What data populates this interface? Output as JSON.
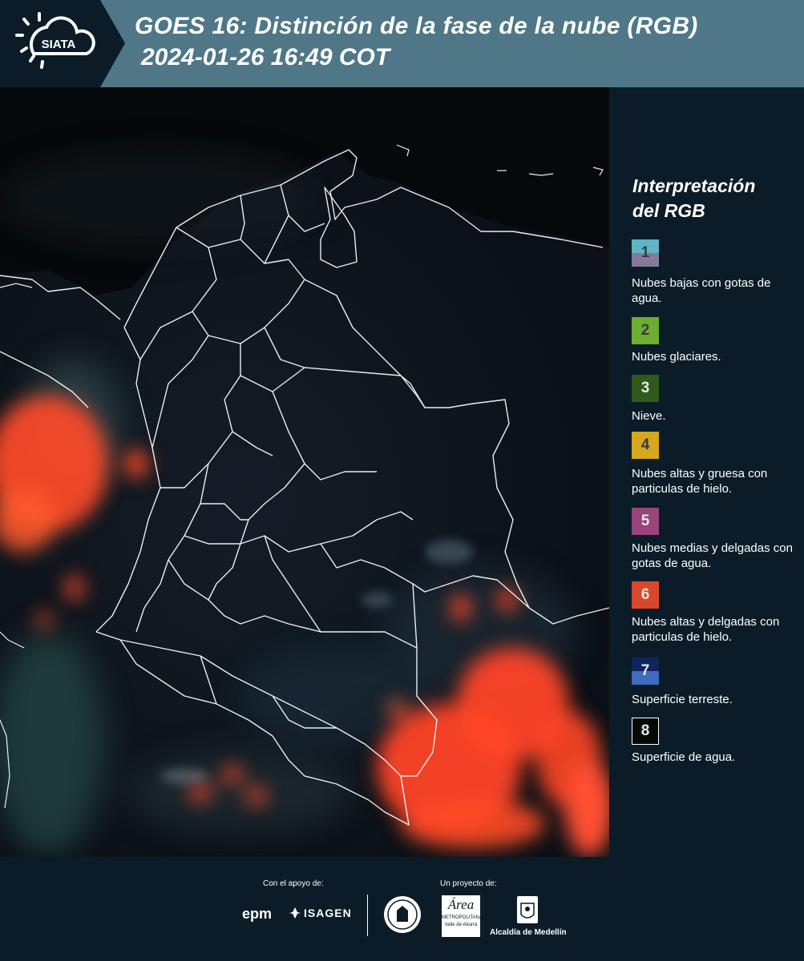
{
  "header": {
    "logo_text": "SIATA",
    "title_line1": "GOES 16: Distinción de la fase de la nube (RGB)",
    "title_line2": "2024-01-26 16:49 COT"
  },
  "legend": {
    "title_line1": "Interpretación",
    "title_line2": "del RGB",
    "items": [
      {
        "number": "1",
        "label": "Nubes bajas con gotas de agua.",
        "color_top": "#5fb5c6",
        "color_bottom": "#857a99"
      },
      {
        "number": "2",
        "label": "Nubes glaciares.",
        "color_top": "#6cae2f",
        "color_bottom": "#6cae2f"
      },
      {
        "number": "3",
        "label": "Nieve.",
        "color_top": "#2f5a1b",
        "color_bottom": "#2f5a1b"
      },
      {
        "number": "4",
        "label": "Nubes altas y gruesa con particulas de hielo.",
        "color_top": "#d7a71d",
        "color_bottom": "#d7a71d"
      },
      {
        "number": "5",
        "label": "Nubes medias y delgadas con gotas de agua.",
        "color_top": "#99447a",
        "color_bottom": "#99447a"
      },
      {
        "number": "6",
        "label": "Nubes altas y delgadas con particulas de hielo.",
        "color_top": "#d9482a",
        "color_bottom": "#d9482a"
      },
      {
        "number": "7",
        "label": "Superficie terreste.",
        "color_top": "#0e2560",
        "color_bottom": "#3f6cc0"
      },
      {
        "number": "8",
        "label": "Superficie de agua.",
        "color_top": "#050a06",
        "color_bottom": "#050a06"
      }
    ]
  },
  "footer": {
    "support_label": "Con el apoyo de:",
    "project_label": "Un proyecto de:",
    "sponsor_epm": "epm",
    "sponsor_isagen": "ISAGEN",
    "partner_area": "Área",
    "partner_area_sub1": "METROPOLITANA",
    "partner_area_sub2": "Valle de Aburrá",
    "partner_alcaldia": "Alcaldía de Medellín"
  },
  "colors": {
    "header_bg": "#4f7787",
    "logo_bg": "#0b1c28",
    "panel_bg": "#0b1c28",
    "cloud_ice": "#ff4a26",
    "border_lines": "#e8eef2"
  }
}
